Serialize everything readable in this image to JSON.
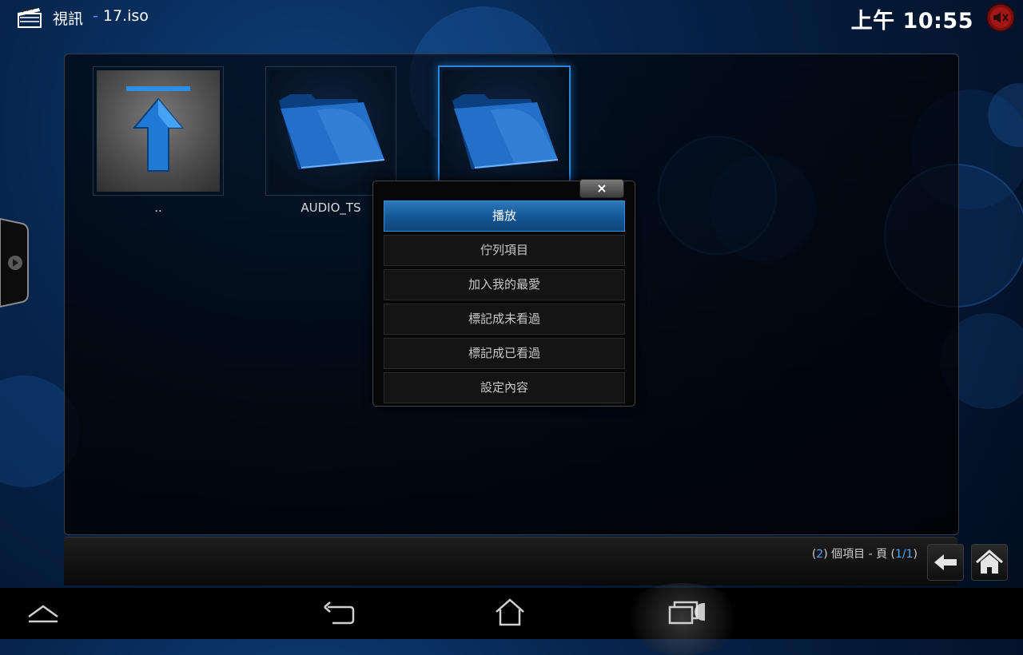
{
  "header": {
    "title": "視訊",
    "separator": "-",
    "path": "17.iso",
    "clock": "上午 10:55",
    "clapboard_icon": "clapboard-icon",
    "mute_icon": "speaker-mute-icon"
  },
  "files": {
    "items": [
      {
        "label": "..",
        "icon": "arrow-up-icon",
        "focused": false
      },
      {
        "label": "AUDIO_TS",
        "icon": "folder-icon",
        "focused": false
      },
      {
        "label": "",
        "icon": "folder-icon",
        "focused": true
      }
    ]
  },
  "context_menu": {
    "close_label": "×",
    "items": [
      "播放",
      "佇列項目",
      "加入我的最愛",
      "標記成未看過",
      "標記成已看過",
      "設定內容"
    ],
    "selected_index": 0
  },
  "footer": {
    "count_open": "(",
    "count": "2",
    "count_mid": ") 個項目 - 頁 (",
    "page": "1/1",
    "count_close": ")"
  },
  "colors": {
    "accent": "#2c86d8",
    "highlight_text": "#4fa6ff"
  }
}
